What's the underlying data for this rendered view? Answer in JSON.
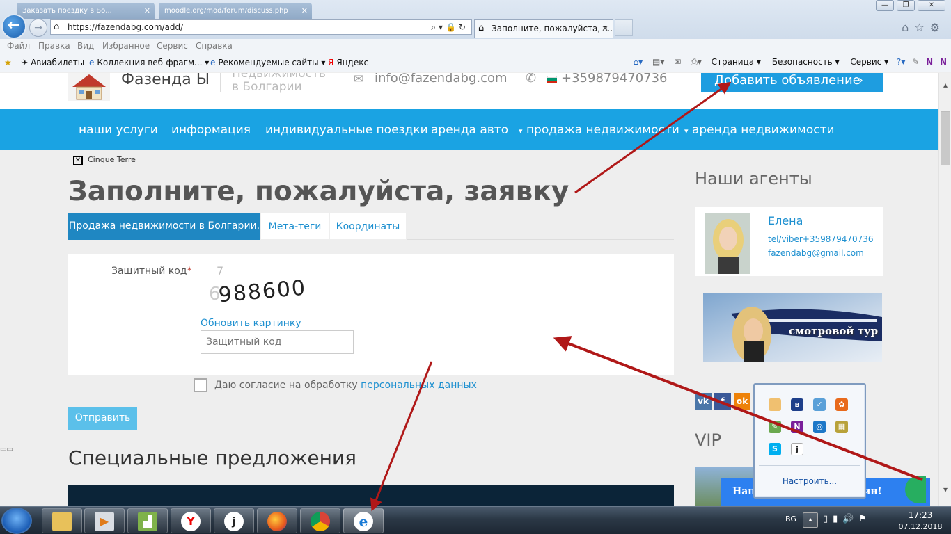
{
  "browser": {
    "prev_tabs": [
      "Заказать поездку в Бо...",
      "moodle.org/mod/forum/discuss.php"
    ],
    "url": "https://fazendabg.com/add/",
    "active_tab_title": "Заполните, пожалуйста, з...",
    "menu": [
      "Файл",
      "Правка",
      "Вид",
      "Избранное",
      "Сервис",
      "Справка"
    ],
    "favorites": [
      "Авиабилеты",
      "Коллекция веб-фрагм...",
      "Рекомендуемые сайты",
      "Яндекс"
    ],
    "commands": [
      "Страница",
      "Безопасность",
      "Сервис"
    ]
  },
  "site": {
    "brand": "Фазенда Ы",
    "tagline_1": "Недвижимость",
    "tagline_2": "в Болгарии",
    "email": "info@fazendabg.com",
    "phone": "+359879470736",
    "add_button": "Добавить объявление",
    "nav": [
      "наши услуги",
      "информация",
      "индивидуальные поездки",
      "аренда авто",
      "продажа недвижимости",
      "аренда недвижимости"
    ]
  },
  "form": {
    "broken_image_alt": "Cinque Terre",
    "title": "Заполните, пожалуйста, заявку",
    "tabs": [
      "Продажа недвижимости в Болгарии.",
      "Мета-теги",
      "Координаты"
    ],
    "captcha_label": "Защитный код",
    "required_mark": "*",
    "captcha_code": "988600",
    "refresh_link": "Обновить картинку",
    "captcha_placeholder": "Защитный код",
    "consent_text": "Даю согласие на обработку ",
    "consent_link": "персональных данных",
    "submit": "Отправить",
    "special_offers": "Специальные предложения"
  },
  "sidebar": {
    "agents_title": "Наши агенты",
    "agent": {
      "name": "Елена",
      "tel": "tel/viber+359879470736",
      "email": "fazendabg@gmail.com"
    },
    "banner_text": "смотровой тур",
    "vip": "VIP",
    "chat_left": "Нап",
    "chat_right": "ин!"
  },
  "tray_popup": {
    "configure": "Настроить..."
  },
  "taskbar": {
    "lang": "BG",
    "time": "17:23",
    "date": "07.12.2018"
  },
  "colors": {
    "accent": "#1aa3e3",
    "button": "#1e9de0",
    "annotation_arrow": "#b01818",
    "dark_block": "#0b2438"
  }
}
